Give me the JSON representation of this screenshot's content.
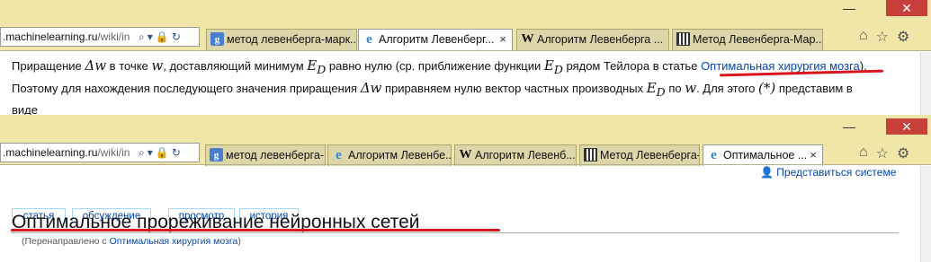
{
  "top_browser": {
    "address": {
      "host": ".machinelearning.ru",
      "path": "/wiki/in"
    },
    "tabs": [
      {
        "label": "метод левенберга-марк...",
        "icon": "google-icon",
        "active": false
      },
      {
        "label": "Алгоритм Левенберг...",
        "icon": "ie-icon",
        "active": true,
        "close": "×"
      },
      {
        "label": "Алгоритм Левенберга ...",
        "icon": "wikipedia-icon",
        "active": false
      },
      {
        "label": "Метод Левенберга-Мар...",
        "icon": "machinelearning-icon",
        "active": false
      }
    ],
    "minimize": "—",
    "close": "✕"
  },
  "article": {
    "line1_a": "Приращение",
    "delta_w": "Δw",
    "line1_b": "в точке",
    "w": "w",
    "line1_c": ", доставляющий минимум",
    "E_D": "E",
    "D_sub": "D",
    "line1_d": "равно нулю (ср. приближение функции",
    "line1_e": "рядом Тейлора в статье",
    "link": "Оптимальная хирургия мозга",
    "line1_end": ").",
    "line2_a": "Поэтому для нахождения последующего значения приращения",
    "line2_b": "приравняем нулю вектор частных производных",
    "line2_c": "по",
    "line2_d": ". Для этого",
    "star": "(*)",
    "line2_e": "представим в",
    "line3": "виде"
  },
  "bottom_browser": {
    "address": {
      "host": ".machinelearning.ru",
      "path": "/wiki/in"
    },
    "tabs": [
      {
        "label": "метод левенберга-мар...",
        "icon": "google-icon",
        "active": false
      },
      {
        "label": "Алгоритм Левенбе...",
        "icon": "ie-icon",
        "active": false
      },
      {
        "label": "Алгоритм Левенб...",
        "icon": "wikipedia-icon",
        "active": false
      },
      {
        "label": "Метод Левенберга-...",
        "icon": "machinelearning-icon",
        "active": false
      },
      {
        "label": "Оптимальное ...",
        "icon": "ie-icon",
        "active": true,
        "close": "×"
      }
    ],
    "minimize": "—",
    "close": "✕"
  },
  "wiki": {
    "login": "Представиться системе",
    "tabs": [
      "статья",
      "обсуждение",
      "просмотр",
      "история"
    ],
    "title": "Оптимальное прореживание нейронных сетей",
    "redirect_prefix": "(Перенаправлено с",
    "redirect_link": "Оптимальная хирургия мозга",
    "redirect_suffix": ")"
  }
}
